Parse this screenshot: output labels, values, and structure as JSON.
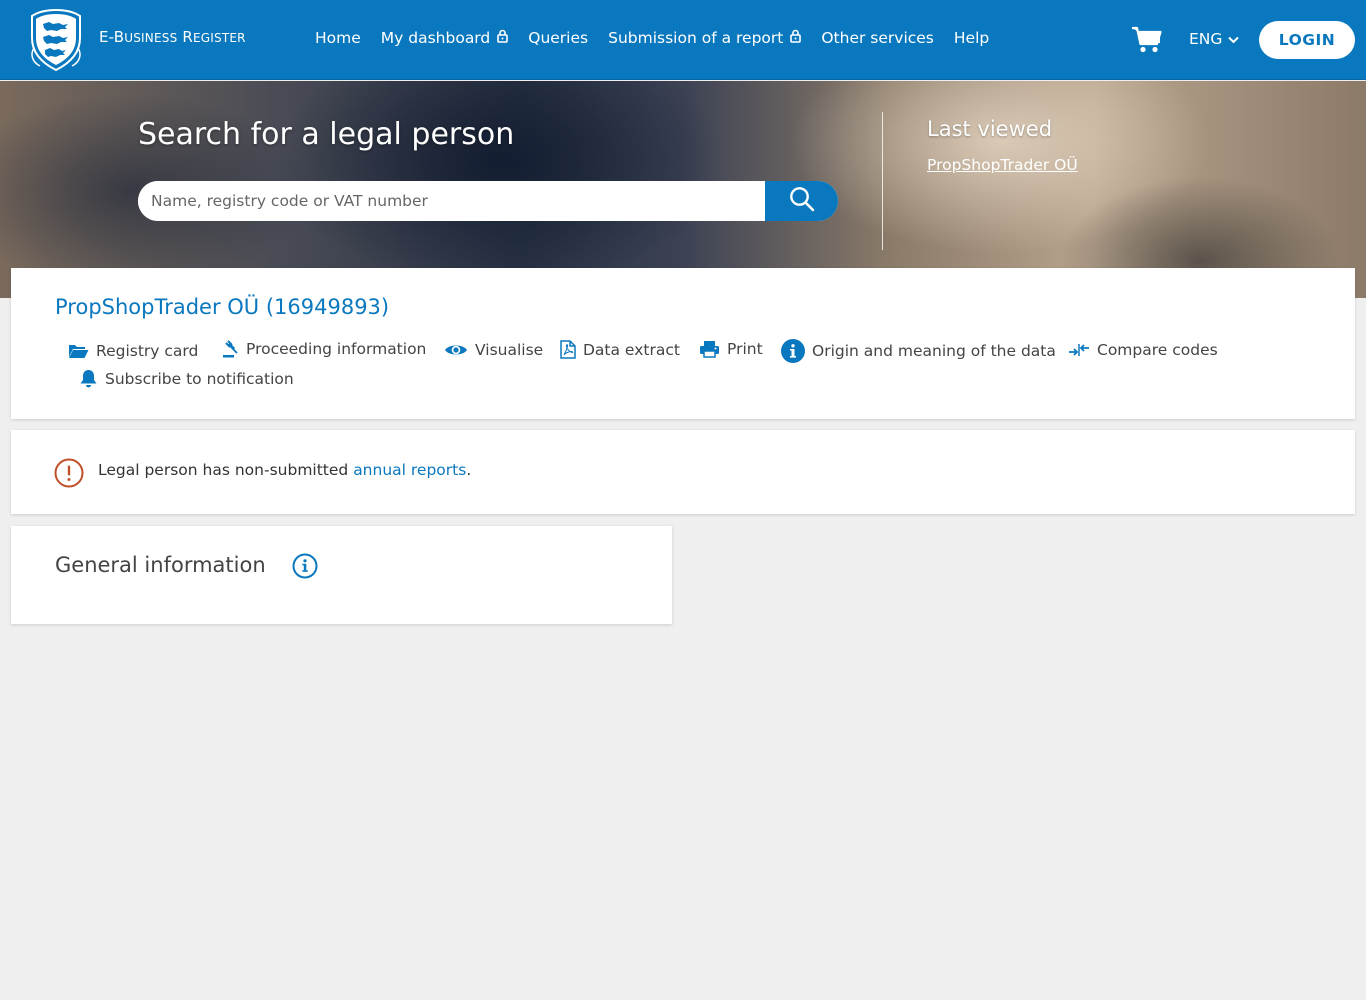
{
  "header": {
    "brand": {
      "prefix_big": "E-B",
      "prefix_small": "USINESS",
      "suffix_big": "R",
      "suffix_small": "EGISTER"
    },
    "nav": [
      {
        "label": "Home",
        "locked": false
      },
      {
        "label": "My dashboard",
        "locked": true
      },
      {
        "label": "Queries",
        "locked": false
      },
      {
        "label": "Submission of a report",
        "locked": true
      },
      {
        "label": "Other services",
        "locked": false
      },
      {
        "label": "Help",
        "locked": false
      }
    ],
    "language": "ENG",
    "login_label": "LOGIN"
  },
  "hero": {
    "title": "Search for a legal person",
    "search_placeholder": "Name, registry code or VAT number",
    "last_viewed_title": "Last viewed",
    "last_viewed_link": "PropShopTrader OÜ"
  },
  "company": {
    "title": "PropShopTrader OÜ (16949893)",
    "actions": {
      "registry_card": "Registry card",
      "proceeding_information": "Proceeding information",
      "visualise": "Visualise",
      "data_extract": "Data extract",
      "print": "Print",
      "origin_meaning": "Origin and meaning of the data",
      "compare_codes": "Compare codes",
      "subscribe": "Subscribe to notification"
    }
  },
  "warning": {
    "text": "Legal person has non-submitted ",
    "link": "annual reports",
    "suffix": "."
  },
  "general": {
    "title": "General information"
  },
  "colors": {
    "primary": "#0a78be",
    "warning": "#c0502a",
    "background": "#efefef"
  }
}
